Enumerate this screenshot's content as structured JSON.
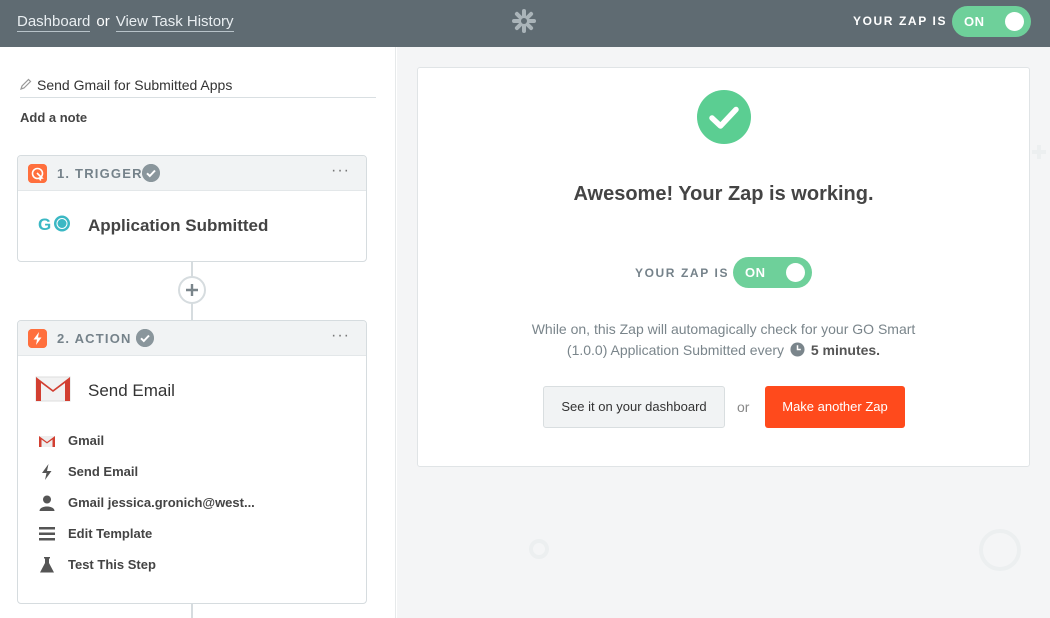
{
  "topbar": {
    "dashboard_link": "Dashboard",
    "or_text": "or",
    "task_history_link": "View Task History",
    "your_zap_is": "YOUR ZAP IS",
    "toggle_label": "ON",
    "logo_icon": "zapier-asterisk-icon"
  },
  "editor": {
    "zap_name": "Send Gmail for Submitted Apps",
    "add_note": "Add a note"
  },
  "steps": {
    "trigger": {
      "title": "1. TRIGGER",
      "app_name": "Application Submitted",
      "app_logo": "go-smart-logo-icon",
      "menu": "···"
    },
    "action": {
      "title": "2. ACTION",
      "app_name": "Send Email",
      "app_logo": "gmail-logo-icon",
      "menu": "···",
      "details": [
        {
          "icon": "gmail-icon",
          "label": "Gmail"
        },
        {
          "icon": "bolt-icon",
          "label": "Send Email"
        },
        {
          "icon": "user-icon",
          "label": "Gmail jessica.gronich@west..."
        },
        {
          "icon": "lines-icon",
          "label": "Edit Template"
        },
        {
          "icon": "flask-icon",
          "label": "Test This Step"
        }
      ]
    }
  },
  "success": {
    "headline": "Awesome! Your Zap is working.",
    "your_zap_is": "YOUR ZAP IS",
    "toggle_label": "ON",
    "desc_line1": "While on, this Zap will automagically check for your GO Smart",
    "desc_line2": "(1.0.0) Application Submitted every",
    "interval": "5 minutes.",
    "see_dashboard_button": "See it on your dashboard",
    "or_text": "or",
    "make_another_button": "Make another Zap"
  },
  "colors": {
    "topbar": "#5f6b72",
    "toggle_on": "#6ed09a",
    "accent_orange": "#ff4a1c",
    "step_icon": "#ff6f3d",
    "success_green": "#5bce92"
  }
}
